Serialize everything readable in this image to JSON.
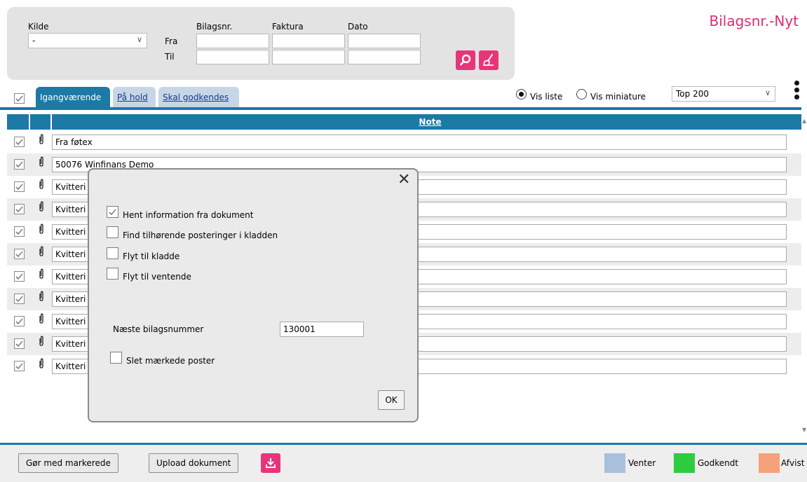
{
  "title": "Bilagsnr.-Nyt",
  "filter": {
    "kilde_label": "Kilde",
    "kilde_value": "-",
    "bilagsnr_label": "Bilagsnr.",
    "faktura_label": "Faktura",
    "dato_label": "Dato",
    "fra_label": "Fra",
    "til_label": "Til"
  },
  "tabs": [
    {
      "label": "Igangværende",
      "active": true
    },
    {
      "label": "På hold",
      "active": false
    },
    {
      "label": "Skal godkendes",
      "active": false
    }
  ],
  "view": {
    "vis_liste": "Vis liste",
    "vis_miniature": "Vis miniature",
    "top_select": "Top 200"
  },
  "grid": {
    "note_header": "Note",
    "rows": [
      "Fra føtex",
      "50076 Winfinans Demo",
      "Kvitteri",
      "Kvitteri",
      "Kvitteri",
      "Kvitteri",
      "Kvitteri",
      "Kvitteri",
      "Kvitteri",
      "Kvitteri",
      "Kvitteri"
    ]
  },
  "dialog": {
    "close": "✕",
    "opt1": "Hent information fra dokument",
    "opt2": "Find tilhørende posteringer i kladden",
    "opt3": "Flyt til kladde",
    "opt4": "Flyt til ventende",
    "next_label": "Næste bilagsnummer",
    "next_value": "130001",
    "delete_label": "Slet mærkede poster",
    "ok": "OK"
  },
  "bottom": {
    "mark_button": "Gør med markerede",
    "upload_button": "Upload dokument",
    "legend": [
      {
        "label": "Venter",
        "color": "#a9bfdc"
      },
      {
        "label": "Godkendt",
        "color": "#2ecc40"
      },
      {
        "label": "Afvist",
        "color": "#f5a27a"
      }
    ]
  },
  "colors": {
    "accent": "#1d79a6",
    "brand": "#e8357a"
  }
}
